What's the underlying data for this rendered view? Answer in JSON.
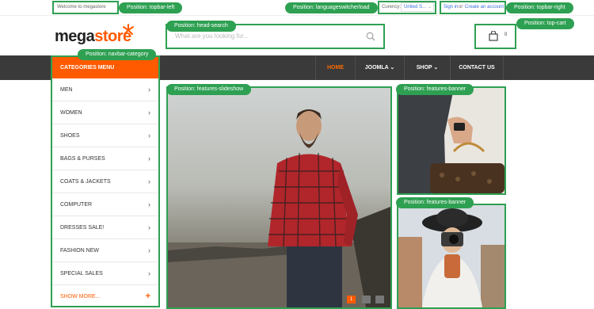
{
  "topbar": {
    "welcome": "Welcome to megastore",
    "currency_label": "Curency:",
    "currency_value": "United S...",
    "sign_in": "Sign in",
    "or": "or",
    "create_account": "Create an account"
  },
  "header": {
    "logo_part1": "mega",
    "logo_part2": "store",
    "search_placeholder": "What are you looking for...",
    "cart_count": "0"
  },
  "nav": {
    "items": [
      {
        "label": "HOME"
      },
      {
        "label": "JOOMLA ⌄"
      },
      {
        "label": "SHOP ⌄"
      },
      {
        "label": "CONTACT US"
      }
    ]
  },
  "categories": {
    "title": "CATEGORIES MENU",
    "items": [
      {
        "label": "MEN"
      },
      {
        "label": "WOMEN"
      },
      {
        "label": "SHOES"
      },
      {
        "label": "BAGS & PURSES"
      },
      {
        "label": "COATS & JACKETS"
      },
      {
        "label": "COMPUTER"
      },
      {
        "label": "DRESSES SALE!"
      },
      {
        "label": "FASHION NEW"
      },
      {
        "label": "SPECIAL SALES"
      }
    ],
    "show_more": "SHOW MORE..."
  },
  "positions": {
    "topbar_left": "Position: topbar-left",
    "language": "Position: languageswitcherload",
    "topbar_right": "Position: topbar-right",
    "head_search": "Position: head-search",
    "top_cart": "Position: top-cart",
    "navbar_category": "Position: navbar-category",
    "slideshow": "Position: features-slideshow",
    "banner1": "Position: features-banner",
    "banner2": "Position: features-banner"
  },
  "slideshow": {
    "pager": [
      "1",
      "",
      ""
    ]
  },
  "colors": {
    "accent": "#ff5a00",
    "position_green": "#2ea052",
    "nav_bg": "#3a3a3a"
  }
}
